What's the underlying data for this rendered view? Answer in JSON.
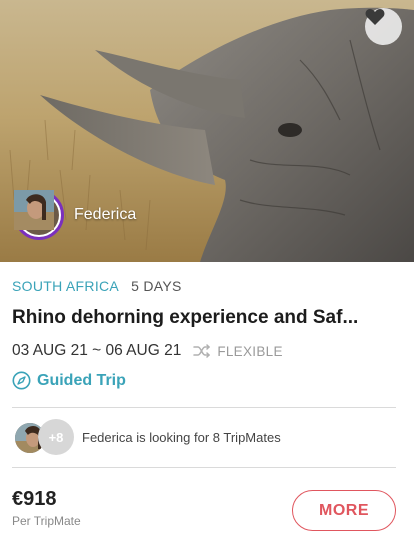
{
  "card": {
    "host_name": "Federica",
    "country": "SOUTH AFRICA",
    "duration": "5 DAYS",
    "title": "Rhino dehorning experience and Saf...",
    "dates": "03 AUG 21 ~ 06 AUG 21",
    "flexible_label": "FLEXIBLE",
    "trip_type": "Guided Trip",
    "mates_extra_count": "+8",
    "mates_text": "Federica is looking for 8 TripMates",
    "price": "€918",
    "price_unit": "Per TripMate",
    "more_label": "MORE"
  },
  "icons": {
    "favorite": "heart-icon",
    "flexible": "shuffle-icon",
    "guided": "compass-icon"
  },
  "colors": {
    "accent_teal": "#3aa3b8",
    "accent_red": "#e0565e",
    "avatar_ring": "#7b2fbe"
  }
}
